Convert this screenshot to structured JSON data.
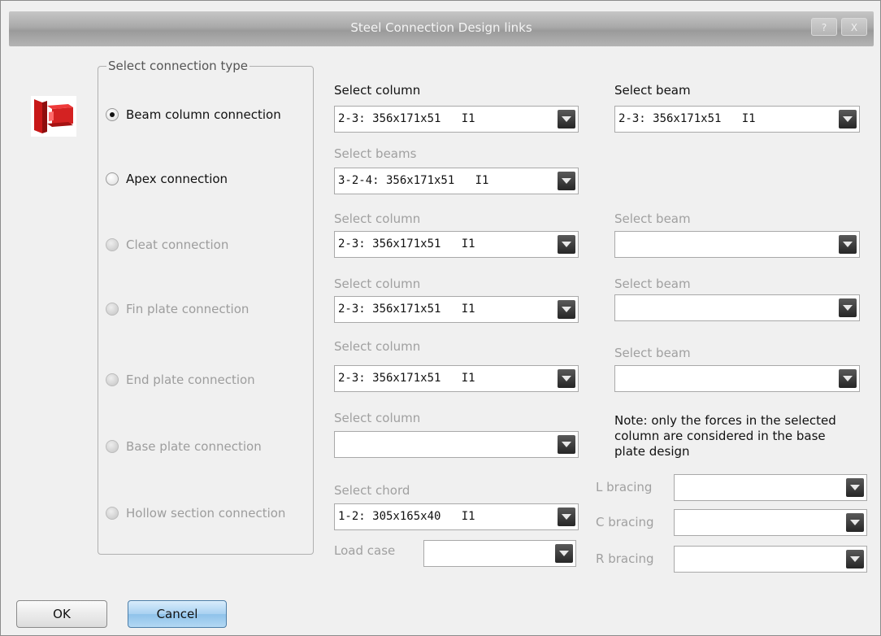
{
  "window": {
    "title": "Steel Connection Design links",
    "help_label": "?",
    "close_label": "X"
  },
  "group": {
    "legend": "Select connection type",
    "options": [
      {
        "label": "Beam column connection",
        "selected": true,
        "enabled": true
      },
      {
        "label": "Apex connection",
        "selected": false,
        "enabled": true
      },
      {
        "label": "Cleat connection",
        "selected": false,
        "enabled": false
      },
      {
        "label": "Fin plate connection",
        "selected": false,
        "enabled": false
      },
      {
        "label": "End plate connection",
        "selected": false,
        "enabled": false
      },
      {
        "label": "Base plate connection",
        "selected": false,
        "enabled": false
      },
      {
        "label": "Hollow section connection",
        "selected": false,
        "enabled": false
      }
    ]
  },
  "beam_column": {
    "column_label": "Select column",
    "column_value": "2-3: 356x171x51   I1",
    "beam_label": "Select beam",
    "beam_value": "2-3: 356x171x51   I1"
  },
  "apex": {
    "beams_label": "Select beams",
    "beams_value": "3-2-4: 356x171x51   I1"
  },
  "cleat": {
    "column_label": "Select column",
    "column_value": "2-3: 356x171x51   I1",
    "beam_label": "Select beam",
    "beam_value": ""
  },
  "fin_plate": {
    "column_label": "Select column",
    "column_value": "2-3: 356x171x51   I1",
    "beam_label": "Select beam",
    "beam_value": ""
  },
  "end_plate": {
    "column_label": "Select column",
    "column_value": "2-3: 356x171x51   I1",
    "beam_label": "Select beam",
    "beam_value": ""
  },
  "base_plate": {
    "column_label": "Select column",
    "column_value": "",
    "note": "Note: only the forces in the selected column are considered in the base plate design"
  },
  "hollow": {
    "chord_label": "Select chord",
    "chord_value": "1-2: 305x165x40   I1",
    "load_case_label": "Load case",
    "load_case_value": "",
    "l_bracing_label": "L bracing",
    "l_bracing_value": "",
    "c_bracing_label": "C bracing",
    "c_bracing_value": "",
    "r_bracing_label": "R bracing",
    "r_bracing_value": ""
  },
  "buttons": {
    "ok": "OK",
    "cancel": "Cancel"
  }
}
